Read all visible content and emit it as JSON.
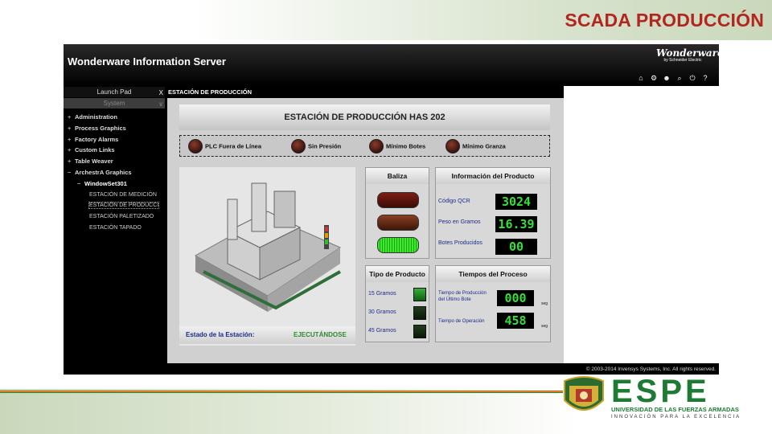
{
  "slide": {
    "title": "SCADA PRODUCCIÓN",
    "brand_colors": {
      "title_red": "#b3261e",
      "espe_green": "#1e7b34"
    }
  },
  "wis": {
    "app_title": "Wonderware Information Server",
    "logo": {
      "wordmark": "Wonderware",
      "sub": "by Schneider Electric"
    },
    "header_icons": [
      "home-icon",
      "settings-icon",
      "user-icon",
      "search-icon",
      "power-icon",
      "help-icon"
    ],
    "help_glyph": "?",
    "launch_pad_label": "Launch Pad",
    "system_label": "System",
    "close_glyph": "X",
    "nav": [
      {
        "label": "Administration",
        "bullet": "+"
      },
      {
        "label": "Process Graphics",
        "bullet": "+"
      },
      {
        "label": "Factory Alarms",
        "bullet": "+"
      },
      {
        "label": "Custom Links",
        "bullet": "+"
      },
      {
        "label": "Table Weaver",
        "bullet": "+"
      },
      {
        "label": "ArchestrA Graphics",
        "bullet": "−"
      }
    ],
    "node": {
      "label": "WindowSet301",
      "bullet": "−"
    },
    "leaves": [
      "ESTACIÓN DE MEDICIÓN",
      "ESTACIÓN DE PRODUCCI",
      "ESTACIÓN PALETIZADO",
      "ESTACIÓN TAPADO"
    ],
    "selected_leaf": 1,
    "content_tab": "ESTACIÓN DE PRODUCCIÓN",
    "footer": "© 2003-2014 Invensys Systems, Inc. All rights reserved."
  },
  "hmi": {
    "title": "ESTACIÓN DE PRODUCCIÓN HAS 202",
    "alarms": [
      "PLC Fuera de Línea",
      "Sin Presión",
      "Mínimo Botes",
      "Mínimo Granza"
    ],
    "state_label": "Estado de la Estación:",
    "state_value": "EJECUTÁNDOSE",
    "baliza": {
      "title": "Baliza",
      "lights": [
        "off-red",
        "off-amber",
        "on-green"
      ]
    },
    "product_info": {
      "title": "Información del Producto",
      "rows": [
        {
          "label": "Código QCR",
          "value": "3024"
        },
        {
          "label": "Peso en Gramos",
          "value": "16.39"
        },
        {
          "label": "Botes Producidos",
          "value": "00"
        }
      ]
    },
    "product_type": {
      "title": "Tipo de Producto",
      "options": [
        {
          "label": "15 Gramos",
          "active": true
        },
        {
          "label": "30 Gramos",
          "active": false
        },
        {
          "label": "45 Gramos",
          "active": false
        }
      ]
    },
    "process_times": {
      "title": "Tiempos del Proceso",
      "rows": [
        {
          "label_1": "Tiempo de Producción",
          "label_2": "del Último Bote",
          "value": "000",
          "unit": "seg"
        },
        {
          "label_1": "Tiempo de Operación",
          "label_2": "",
          "value": "458",
          "unit": "seg"
        }
      ]
    }
  },
  "espe": {
    "name": "ESPE",
    "line1": "UNIVERSIDAD DE LAS FUERZAS ARMADAS",
    "line2": "INNOVACIÓN PARA LA EXCELENCIA"
  }
}
